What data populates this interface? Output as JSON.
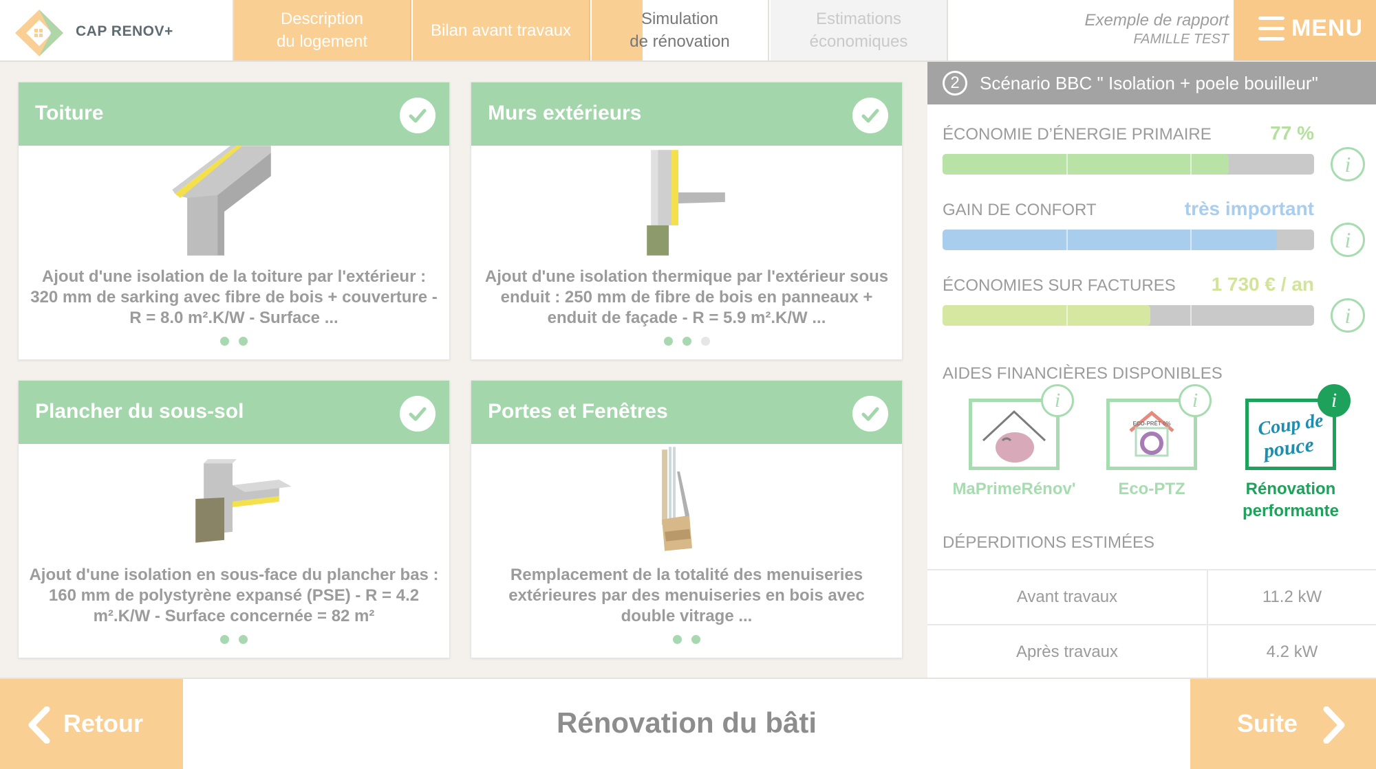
{
  "app": {
    "name": "CAP RENOV+"
  },
  "nav": {
    "tabs": [
      {
        "label": "Description\ndu logement",
        "state": "done"
      },
      {
        "label": "Bilan avant travaux",
        "state": "done"
      },
      {
        "label": "Simulation\nde rénovation",
        "state": "current"
      },
      {
        "label": "Estimations\néconomiques",
        "state": "todo"
      }
    ]
  },
  "report": {
    "line1": "Exemple de rapport",
    "line2": "FAMILLE TEST"
  },
  "menu": {
    "label": "MENU",
    "icon": "hamburger-icon"
  },
  "cards": [
    {
      "title": "Toiture",
      "icon": "roof-insulation-illustration",
      "description": "Ajout d'une isolation de la toiture par l'extérieur : 320 mm de sarking avec fibre de bois + couverture - R = 8.0 m².K/W - Surface ...",
      "pages": 2,
      "active_page": 2
    },
    {
      "title": "Murs extérieurs",
      "icon": "wall-insulation-illustration",
      "description": "Ajout d'une isolation thermique par l'extérieur sous enduit : 250 mm de fibre de bois en panneaux + enduit de façade - R = 5.9 m².K/W ...",
      "pages": 3,
      "active_page": 2
    },
    {
      "title": "Plancher du sous-sol",
      "icon": "floor-insulation-illustration",
      "description": "Ajout d'une isolation en sous-face du plancher bas : 160 mm de polystyrène expansé (PSE) - R = 4.2 m².K/W - Surface concernée = 82 m²",
      "pages": 2,
      "active_page": 2
    },
    {
      "title": "Portes et Fenêtres",
      "icon": "window-frame-illustration",
      "description": "Remplacement de la totalité des menuiseries extérieures par des menuiseries en bois avec double vitrage ...",
      "pages": 2,
      "active_page": 2
    }
  ],
  "scenario": {
    "number": "2",
    "title": "Scénario BBC \" Isolation + poele bouilleur\""
  },
  "metrics": [
    {
      "label": "ÉCONOMIE D’ÉNERGIE PRIMAIRE",
      "value": "77 %",
      "fraction": 0.77,
      "color": "#b9e3a6",
      "text_color": "#b5df9f"
    },
    {
      "label": "GAIN DE CONFORT",
      "value": "très important",
      "fraction": 0.9,
      "color": "#a9cdec",
      "text_color": "#a9cdec"
    },
    {
      "label": "ÉCONOMIES SUR FACTURES",
      "value": "1 730 € / an",
      "fraction": 0.56,
      "color": "#d6e7a1",
      "text_color": "#d2e39a"
    }
  ],
  "aides": {
    "title": "AIDES FINANCIÈRES DISPONIBLES",
    "items": [
      {
        "label": "MaPrimeRénov'",
        "icon": "maprimerenov-logo",
        "strong": false
      },
      {
        "label": "Eco-PTZ",
        "icon": "eco-ptz-logo",
        "logo_text": "ECO-PRÊT 0%",
        "strong": false
      },
      {
        "label": "Rénovation performante",
        "icon": "coup-de-pouce-logo",
        "logo_text": "Coup de pouce",
        "strong": true
      }
    ]
  },
  "deperditions": {
    "title": "DÉPERDITIONS ESTIMÉES",
    "rows": [
      {
        "label": "Avant travaux",
        "value": "11.2 kW"
      },
      {
        "label": "Après travaux",
        "value": "4.2 kW"
      }
    ]
  },
  "footer": {
    "back": "Retour",
    "title": "Rénovation du bâti",
    "next": "Suite"
  }
}
